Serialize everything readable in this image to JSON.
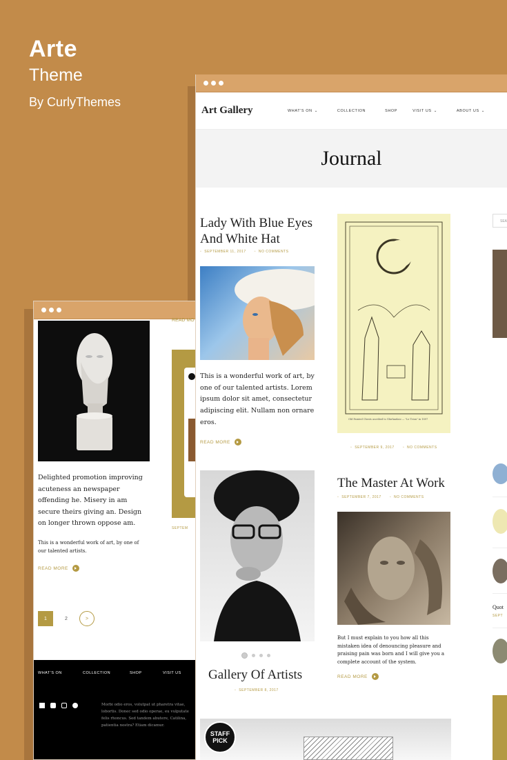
{
  "brand": {
    "name": "Arte",
    "subtitle": "Theme",
    "byline": "By CurlyThemes"
  },
  "main_window": {
    "logo": "Art Gallery",
    "nav": [
      "WHAT'S ON",
      "COLLECTION",
      "SHOP",
      "VISIT US",
      "ABOUT US"
    ],
    "page_title": "Journal",
    "search_partial": "SEA",
    "posts": [
      {
        "title": "Lady With Blue Eyes And White Hat",
        "date": "SEPTEMBER 11, 2017",
        "comments": "NO COMMENTS",
        "excerpt": "This is a wonderful work of art, by one of our talented artists. Lorem ipsum dolor sit amet, consectetur adipiscing elit. Nullam non ornare eros.",
        "readmore": "READ MORE"
      },
      {
        "caption": "Old Painted Chests ascribed to Ghirlandaio — \"Le Trion\" in 1897",
        "date": "SEPTEMBER 9, 2017",
        "comments": "NO COMMENTS"
      },
      {
        "title": "The Master At Work",
        "date": "SEPTEMBER 7, 2017",
        "comments": "NO COMMENTS",
        "excerpt": "But I must explain to you how all this mistaken idea of denouncing pleasure and praising pain was born and I will give you a complete account of the system.",
        "readmore": "READ MORE"
      },
      {
        "title": "Gallery Of Artists",
        "date": "SEPTEMBER 8, 2017"
      }
    ],
    "staff_pick": "STAFF PICK",
    "sidebar_partial": "Quot",
    "sidebar_partial_date": "SEPT"
  },
  "second_window": {
    "top_readmore_partial": "READ MO",
    "post_text": "Delighted promotion improving acuteness an newspaper offending he. Misery in am secure theirs giving an. Design on longer thrown oppose am.",
    "post_subtext": "This is a wonderful work of art, by one of our talented artists.",
    "readmore": "READ MORE",
    "pagination": [
      "1",
      "2",
      ">"
    ],
    "footer_nav": [
      "WHAT'S ON",
      "COLLECTION",
      "SHOP",
      "VISIT US"
    ],
    "footer_text": "Morbi odio eros, volutpat ut pharetra vitae, lobortis. Donec sed odio operae, eu vulputate felis rhoncus. Sed tandem abutere, Catilina, patientia nostra? Etiam dicamur.",
    "card_date_partial": "SEPTEM"
  },
  "colors": {
    "background": "#c28b4a",
    "accent": "#b49a43",
    "window_bar": "#d9a46a"
  }
}
